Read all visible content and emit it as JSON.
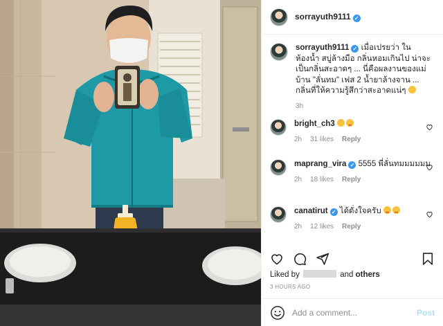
{
  "post": {
    "author": "sorrayuth9111",
    "caption": "เมื่อเปรยว่า ในห้องน้ำ สบู่ล้างมือ กลิ่นหอมเกินไป น่าจะเป็นกลิ่นสะอาดๆ ... นี่คือผลงานของแม่บ้าน \"ลั่นทม\" เฟส 2 น้ำยาล้างจาน ... กลิ่นที่ให้ความรู้สึกว่าสะอาดแน่ๆ",
    "caption_time": "3h"
  },
  "comments": [
    {
      "user": "bright_ch3",
      "verified": false,
      "text": "",
      "time": "2h",
      "likes": "31 likes",
      "reply": "Reply"
    },
    {
      "user": "maprang_vira",
      "verified": true,
      "text": "5555 พี่ลั่นทมมมมมม",
      "time": "2h",
      "likes": "18 likes",
      "reply": "Reply"
    },
    {
      "user": "canatirut",
      "verified": true,
      "text": "ได้ดั่งใจครับ",
      "time": "2h",
      "likes": "12 likes",
      "reply": "Reply"
    }
  ],
  "likes": {
    "prefix": "Liked by",
    "and": "and",
    "others": "others"
  },
  "timestamp": "3 HOURS AGO",
  "add_comment": {
    "placeholder": "Add a comment...",
    "post_label": "Post"
  },
  "colors": {
    "verified": "#3897f0",
    "post_button": "#b2dffc",
    "meta_gray": "#8e8e8e"
  },
  "icons": [
    "heart-icon",
    "comment-icon",
    "share-icon",
    "bookmark-icon",
    "smiley-icon",
    "verified-badge-icon"
  ]
}
